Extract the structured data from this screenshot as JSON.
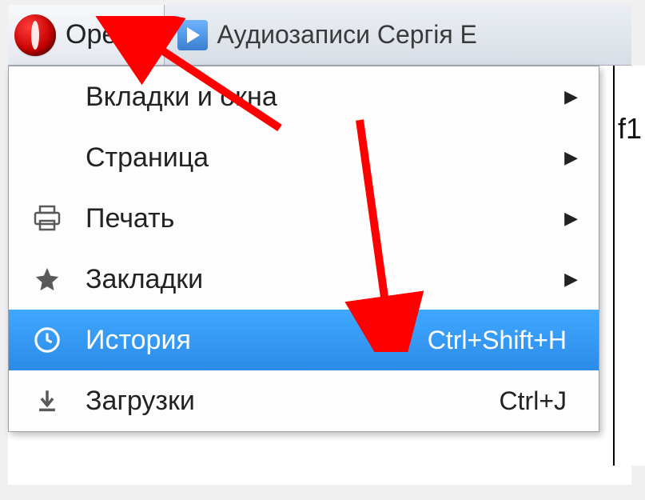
{
  "titlebar": {
    "app_name": "Opera",
    "tab_title": "Аудиозаписи Сергія Е"
  },
  "menu": {
    "items": [
      {
        "icon": "",
        "label": "Вкладки и окна",
        "shortcut": "",
        "submenu": true,
        "highlight": false
      },
      {
        "icon": "",
        "label": "Страница",
        "shortcut": "",
        "submenu": true,
        "highlight": false
      },
      {
        "icon": "print",
        "label": "Печать",
        "shortcut": "",
        "submenu": true,
        "highlight": false
      },
      {
        "icon": "star",
        "label": "Закладки",
        "shortcut": "",
        "submenu": true,
        "highlight": false
      },
      {
        "icon": "clock",
        "label": "История",
        "shortcut": "Ctrl+Shift+H",
        "submenu": false,
        "highlight": true
      },
      {
        "icon": "download",
        "label": "Загрузки",
        "shortcut": "Ctrl+J",
        "submenu": false,
        "highlight": false
      }
    ]
  },
  "side": {
    "fragment": "f1"
  },
  "annotations": {
    "arrow1_target": "opera-menu-button",
    "arrow2_target": "menu-item-history"
  }
}
